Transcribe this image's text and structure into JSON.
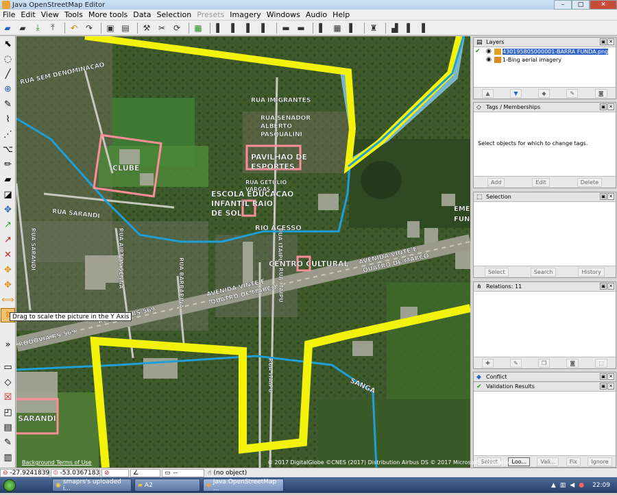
{
  "window": {
    "title": "Java OpenStreetMap Editor"
  },
  "menu": [
    "File",
    "Edit",
    "View",
    "Tools",
    "More tools",
    "Data",
    "Selection",
    "Presets",
    "Imagery",
    "Windows",
    "Audio",
    "Help"
  ],
  "tooltip": "Drag to scale the picture in the Y Axis",
  "map": {
    "labels": {
      "rua_sem_denominacao": "RUA SEM DENOMINAÇÃO",
      "rua_imigrantes": "RUA IMIGRANTES",
      "rua_senador": "RUA SENADOR",
      "alberto": "ALBERTO",
      "pasqualini": "PASQUALINI",
      "pavilhao1": "PAVILHAO DE",
      "pavilhao2": "ESPORTES",
      "clube": "CLUBE",
      "rua_getulio": "RUA GETULIO",
      "vargas": "VARGAS",
      "escola1": "ESCOLA EDUCACAO",
      "escola2": "INFANTIL RAIO",
      "escola3": "DE SOL",
      "rua_sarandi": "RUA SARANDI",
      "rio_acesso": "RIO ACESSO",
      "rua_sarandi_v": "RUA SARANDI",
      "rua_airton_senna": "RUA AIRTON SENNA",
      "rua_itaipu": "RUA ITAIPU",
      "rua_itaipu2": "RUA ITAIPU",
      "rua_itaipu3": "RUA ITAIPU",
      "centro_cultural": "CENTRO CULTURAL",
      "av_vinte_1": "AVENIDA VINTE E",
      "av_vinte_2": "QUATRO DE MARCO",
      "av_vinte_b1": "AVENIDA VINTE E",
      "av_vinte_b2": "QUATRO DE MARCO",
      "rua_barbarina": "RUA BARBARINA",
      "rodovia1": "RODOVIA RS 569",
      "rodovia2": "RODOVIA RS 569",
      "sanga": "SANGA",
      "sarandi": "SARANDI",
      "eme": "EME",
      "fund": "FUND"
    },
    "attribution": "© 2017 DigitalGlobe ©CNES (2017) Distribution Airbus DS © 2017 Microsoft Corporation",
    "terms": "Background Terms of Use"
  },
  "layers_panel": {
    "title": "Layers",
    "layers": [
      {
        "name": "430195805000001-BARRA FUNDA.png",
        "active": true
      },
      {
        "name": "1-Bing aerial imagery",
        "active": false
      }
    ]
  },
  "tags_panel": {
    "title": "Tags / Memberships",
    "empty_text": "Select objects for which to change tags.",
    "buttons": [
      "Add",
      "Edit",
      "Delete"
    ]
  },
  "selection_panel": {
    "title": "Selection",
    "buttons": [
      "Select",
      "Search",
      "History"
    ]
  },
  "relations_panel": {
    "title": "Relations: 11"
  },
  "conflict_panel": {
    "title": "Conflict"
  },
  "validation_panel": {
    "title": "Validation Results",
    "buttons": [
      "Select",
      "Loo...",
      "Vali...",
      "Fix",
      "Ignore"
    ]
  },
  "status": {
    "lat": "-27.9241839",
    "lon": "-53.0367183",
    "heading": "",
    "angle": "",
    "length": "--",
    "object": "(no object)"
  },
  "taskbar": {
    "items": [
      "smaprs's uploaded i...",
      "A2",
      "Java OpenStreetMap ..."
    ],
    "clock": "22:09"
  }
}
